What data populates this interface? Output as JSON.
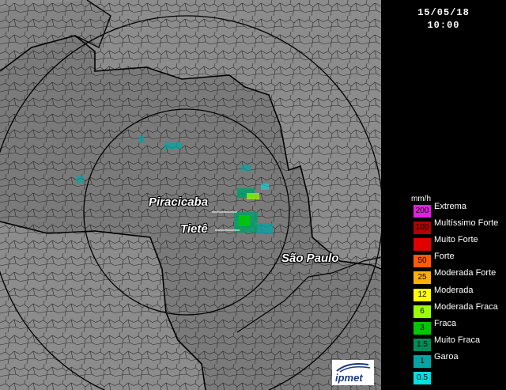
{
  "timestamp": {
    "date": "15/05/18",
    "time": "10:00"
  },
  "places": [
    {
      "name": "Piracicaba"
    },
    {
      "name": "Tietê"
    },
    {
      "name": "São Paulo"
    }
  ],
  "logo": {
    "text": "ipmet"
  },
  "legend": {
    "unit": "mm/h",
    "items": [
      {
        "value": "200",
        "label": "Extrema",
        "color": "#e020e0"
      },
      {
        "value": "100",
        "label": "Multíssimo Forte",
        "color": "#b40000"
      },
      {
        "value": "",
        "label": "Muito Forte",
        "color": "#e00000"
      },
      {
        "value": "50",
        "label": "Forte",
        "color": "#ff5a00"
      },
      {
        "value": "25",
        "label": "Moderada Forte",
        "color": "#ffb000"
      },
      {
        "value": "12",
        "label": "Moderada",
        "color": "#ffff00"
      },
      {
        "value": "6",
        "label": "Moderada Fraca",
        "color": "#9cff00"
      },
      {
        "value": "3",
        "label": "Fraca",
        "color": "#00c800"
      },
      {
        "value": "1.5",
        "label": "Muito Fraca",
        "color": "#008c5a"
      },
      {
        "value": "1",
        "label": "Garoa",
        "color": "#00a6a6"
      },
      {
        "value": "0.5",
        "label": "",
        "color": "#00e0e0"
      }
    ]
  }
}
